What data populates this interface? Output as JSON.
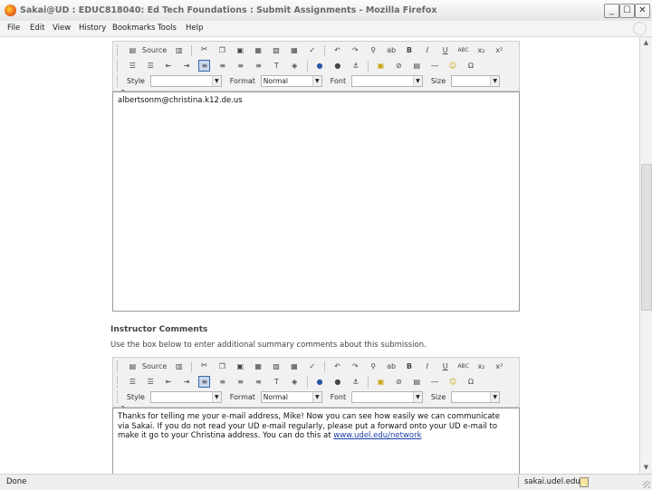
{
  "window": {
    "title": "Sakai@UD : EDUC818040: Ed Tech Foundations : Submit Assignments - Mozilla Firefox",
    "controls": {
      "minimize": "_",
      "maximize": "☐",
      "close": "✕"
    }
  },
  "menubar": {
    "items": [
      "File",
      "Edit",
      "View",
      "History",
      "Bookmarks",
      "Tools",
      "Help"
    ]
  },
  "editor_toolbar": {
    "source_label": "Source",
    "bold": "B",
    "italic": "I",
    "underline": "U",
    "strike": "ABC",
    "subscript": "x₂",
    "superscript": "x²",
    "help": "?",
    "style_label": "Style",
    "format_label": "Format",
    "format_value": "Normal",
    "font_label": "Font",
    "size_label": "Size",
    "style_value": "",
    "font_value": "",
    "size_value": ""
  },
  "submission": {
    "text": "albertsonm@christina.k12.de.us"
  },
  "instructor_comments": {
    "heading": "Instructor Comments",
    "help": "Use the box below to enter additional summary comments about this submission.",
    "text_before_link": "Thanks for telling me your e-mail address, Mike! Now you can see how easily we can communicate via Sakai. If you do not read your UD e-mail regularly, please put a forward onto your UD e-mail to make it go to your Christina address. You can do this at ",
    "link_text": "www.udel.edu/network"
  },
  "statusbar": {
    "left": "Done",
    "domain": "sakai.udel.edu"
  },
  "colors": {
    "selected_button_bg": "#c9d8ee",
    "link": "#1a3ea8"
  }
}
